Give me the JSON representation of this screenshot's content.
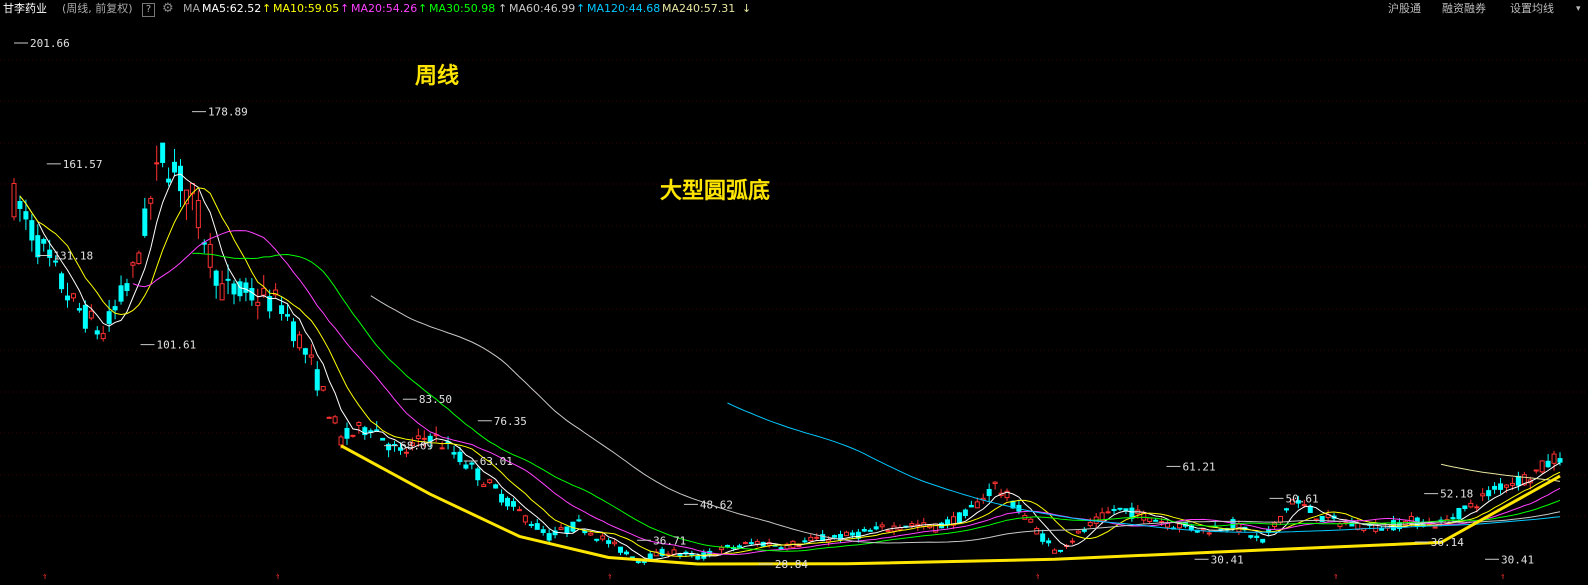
{
  "header": {
    "stock_name": "甘李药业",
    "mode": "(周线, 前复权)",
    "help_icon": "?",
    "settings_icon": "gear-icon",
    "ma_label": "MA",
    "ma_items": [
      {
        "label": "MA5:62.52",
        "arrow": "",
        "color": "#ffffff"
      },
      {
        "label": "MA10:59.05",
        "arrow": "↑",
        "color": "#ffff00"
      },
      {
        "label": "MA20:54.26",
        "arrow": "↑",
        "color": "#ff40ff"
      },
      {
        "label": "MA30:50.98",
        "arrow": "↑",
        "color": "#00ff00"
      },
      {
        "label": "MA60:46.99",
        "arrow": "↑",
        "color": "#c8c8c8"
      },
      {
        "label": "MA120:44.68",
        "arrow": "↑",
        "color": "#00c8ff"
      },
      {
        "label": "MA240:57.31",
        "arrow": "↓",
        "color": "#e6e6a0"
      }
    ],
    "right_links": [
      "沪股通",
      "融资融券",
      "设置均线"
    ]
  },
  "annotations": {
    "period": "周线",
    "pattern": "大型圆弧底"
  },
  "chart_data": {
    "type": "candlestick",
    "price_labels": [
      {
        "label": "201.66",
        "value": 201.66
      },
      {
        "label": "178.89",
        "value": 178.89
      },
      {
        "label": "161.57",
        "value": 161.57
      },
      {
        "label": "131.18",
        "value": 131.18
      },
      {
        "label": "101.61",
        "value": 101.61
      },
      {
        "label": "83.50",
        "value": 83.5
      },
      {
        "label": "76.35",
        "value": 76.35
      },
      {
        "label": "68.09",
        "value": 68.09
      },
      {
        "label": "63.01",
        "value": 63.01
      },
      {
        "label": "48.62",
        "value": 48.62
      },
      {
        "label": "36.71",
        "value": 36.71
      },
      {
        "label": "28.84",
        "value": 28.84
      },
      {
        "label": "61.21",
        "value": 61.21
      },
      {
        "label": "50.61",
        "value": 50.61
      },
      {
        "label": "52.18",
        "value": 52.18
      },
      {
        "label": "30.41",
        "value": 30.41
      },
      {
        "label": "36.14",
        "value": 36.14
      },
      {
        "label": "30.41",
        "value": 30.41
      }
    ],
    "ma_latest": {
      "MA5": 62.52,
      "MA10": 59.05,
      "MA20": 54.26,
      "MA30": 50.98,
      "MA60": 46.99,
      "MA120": 44.68,
      "MA240": 57.31
    },
    "price_path": [
      {
        "t": 0,
        "close": 150
      },
      {
        "t": 5,
        "close": 132
      },
      {
        "t": 10,
        "close": 115
      },
      {
        "t": 15,
        "close": 105
      },
      {
        "t": 20,
        "close": 125
      },
      {
        "t": 25,
        "close": 165
      },
      {
        "t": 30,
        "close": 150
      },
      {
        "t": 35,
        "close": 120
      },
      {
        "t": 40,
        "close": 118
      },
      {
        "t": 45,
        "close": 115
      },
      {
        "t": 50,
        "close": 95
      },
      {
        "t": 55,
        "close": 70
      },
      {
        "t": 60,
        "close": 75
      },
      {
        "t": 65,
        "close": 65
      },
      {
        "t": 70,
        "close": 72
      },
      {
        "t": 75,
        "close": 64
      },
      {
        "t": 80,
        "close": 55
      },
      {
        "t": 85,
        "close": 46
      },
      {
        "t": 90,
        "close": 38
      },
      {
        "t": 95,
        "close": 42
      },
      {
        "t": 100,
        "close": 36
      },
      {
        "t": 105,
        "close": 30
      },
      {
        "t": 110,
        "close": 33
      },
      {
        "t": 115,
        "close": 31
      },
      {
        "t": 120,
        "close": 34
      },
      {
        "t": 125,
        "close": 36
      },
      {
        "t": 130,
        "close": 35
      },
      {
        "t": 135,
        "close": 37
      },
      {
        "t": 140,
        "close": 38
      },
      {
        "t": 145,
        "close": 40
      },
      {
        "t": 150,
        "close": 42
      },
      {
        "t": 155,
        "close": 41
      },
      {
        "t": 160,
        "close": 45
      },
      {
        "t": 165,
        "close": 55
      },
      {
        "t": 170,
        "close": 45
      },
      {
        "t": 175,
        "close": 33
      },
      {
        "t": 180,
        "close": 40
      },
      {
        "t": 185,
        "close": 47
      },
      {
        "t": 190,
        "close": 45
      },
      {
        "t": 195,
        "close": 42
      },
      {
        "t": 200,
        "close": 40
      },
      {
        "t": 205,
        "close": 42
      },
      {
        "t": 210,
        "close": 36
      },
      {
        "t": 215,
        "close": 50
      },
      {
        "t": 220,
        "close": 44
      },
      {
        "t": 225,
        "close": 42
      },
      {
        "t": 230,
        "close": 41
      },
      {
        "t": 235,
        "close": 43
      },
      {
        "t": 240,
        "close": 42
      },
      {
        "t": 245,
        "close": 48
      },
      {
        "t": 250,
        "close": 55
      },
      {
        "t": 255,
        "close": 58
      },
      {
        "t": 260,
        "close": 65
      }
    ],
    "bottom_arc": [
      {
        "t": 55,
        "value": 68.09
      },
      {
        "t": 70,
        "value": 52
      },
      {
        "t": 85,
        "value": 38
      },
      {
        "t": 100,
        "value": 31
      },
      {
        "t": 115,
        "value": 28.84
      },
      {
        "t": 140,
        "value": 28.9
      },
      {
        "t": 175,
        "value": 30.41
      },
      {
        "t": 210,
        "value": 33.5
      },
      {
        "t": 240,
        "value": 36
      },
      {
        "t": 260,
        "value": 58
      }
    ]
  }
}
